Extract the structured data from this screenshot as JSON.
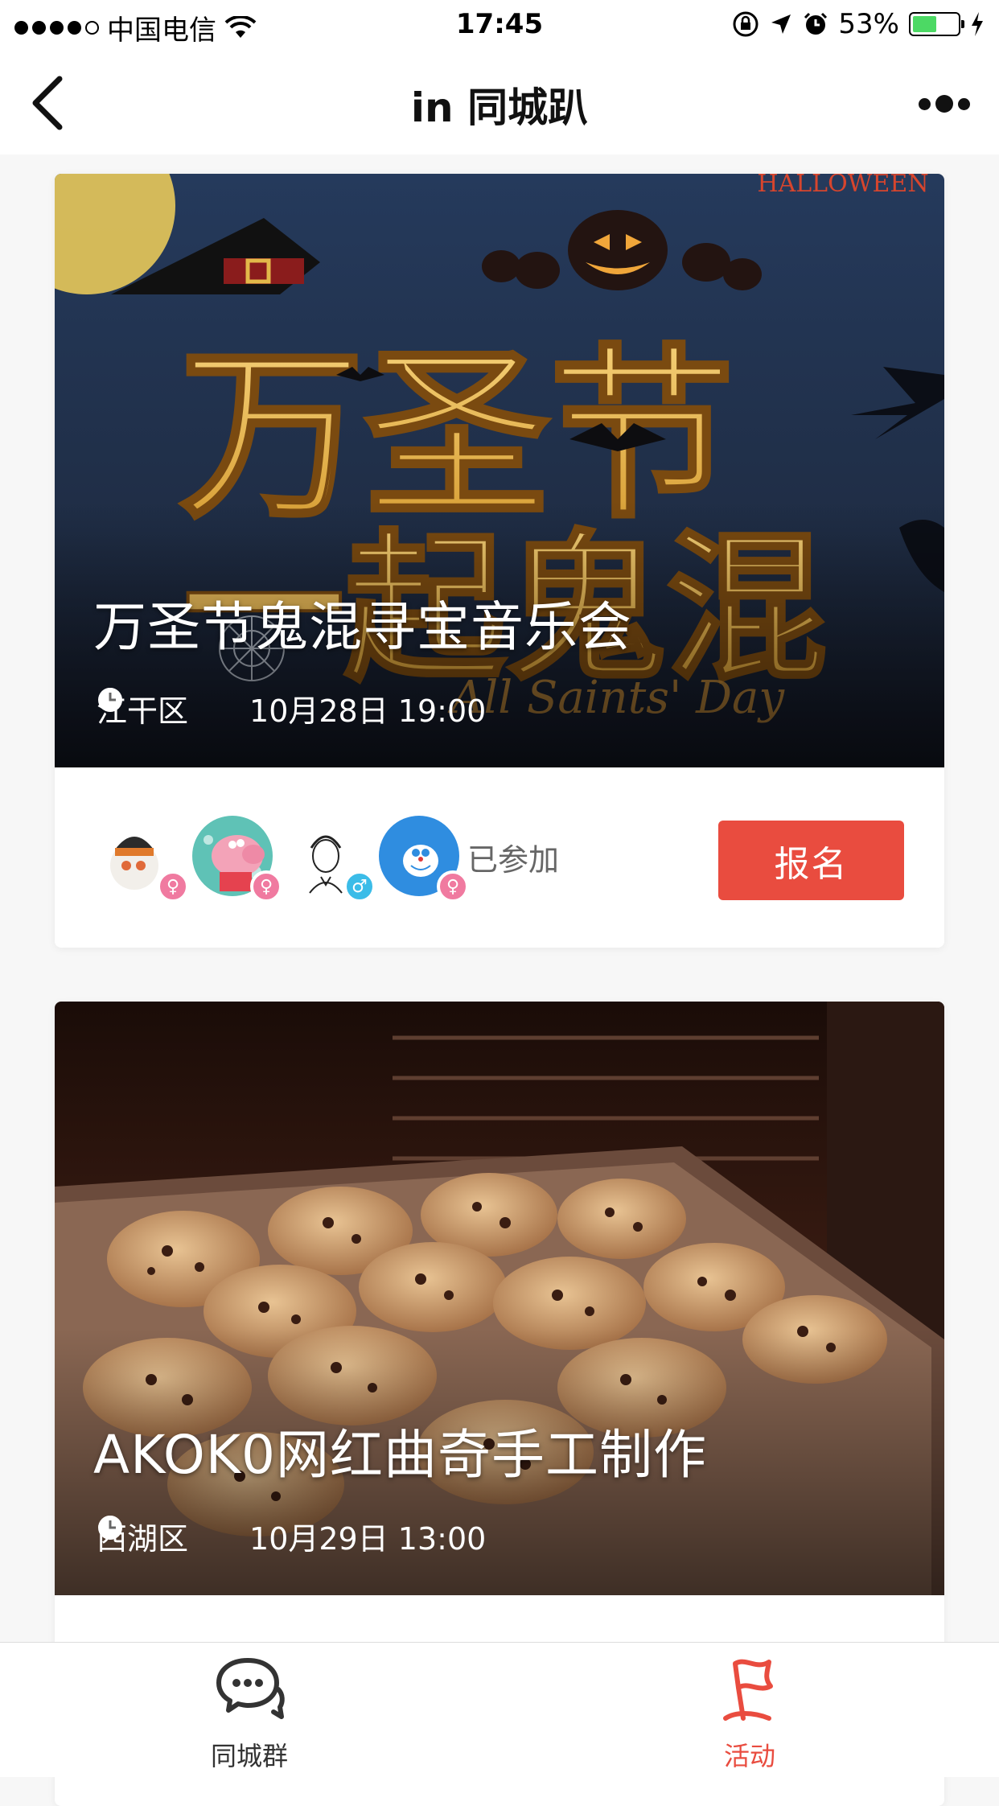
{
  "status_bar": {
    "carrier": "中国电信",
    "time": "17:45",
    "battery_text": "53%",
    "battery_level": 0.53
  },
  "nav": {
    "title": "in 同城趴"
  },
  "events": [
    {
      "title": "万圣节鬼混寻宝音乐会",
      "location": "江干区",
      "datetime": "10月28日 19:00",
      "poster_text": [
        "万圣节",
        "一起鬼混",
        "HALLOWEEN",
        "All Saints' Day"
      ],
      "joined_label": "已参加",
      "signup_label": "报名",
      "participants": [
        {
          "gender": "female",
          "badge_color": "#f07aa0"
        },
        {
          "gender": "female",
          "badge_color": "#f07aa0"
        },
        {
          "gender": "male",
          "badge_color": "#3bbce8"
        },
        {
          "gender": "female",
          "badge_color": "#f07aa0"
        }
      ]
    },
    {
      "title": "AKOK0网红曲奇手工制作",
      "location": "西湖区",
      "datetime": "10月29日 13:00"
    }
  ],
  "tabs": [
    {
      "label": "同城群",
      "icon": "chat-bubbles-icon",
      "active": false
    },
    {
      "label": "活动",
      "icon": "flag-icon",
      "active": true
    }
  ],
  "colors": {
    "accent": "#e94c3f",
    "female_badge": "#f07aa0",
    "male_badge": "#3bbce8"
  }
}
